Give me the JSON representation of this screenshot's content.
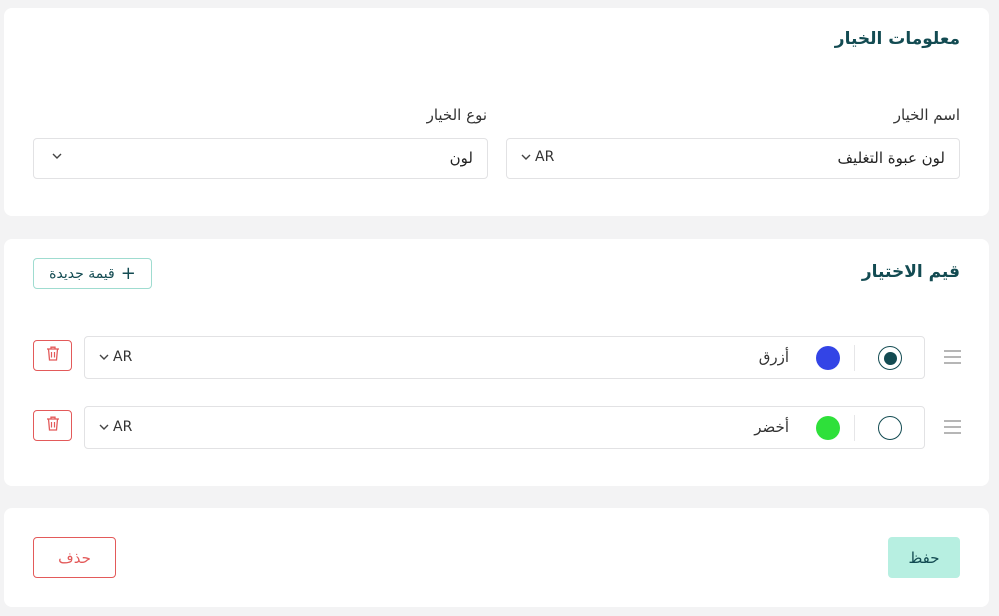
{
  "option_info": {
    "title": "معلومات الخيار",
    "name_label": "اسم الخيار",
    "name_value": "لون عبوة التغليف",
    "name_lang": "AR",
    "type_label": "نوع الخيار",
    "type_value": "لون"
  },
  "option_values": {
    "title": "قيم الاختيار",
    "new_value_label": "قيمة جديدة",
    "rows": [
      {
        "label": "أزرق",
        "color": "#3344e6",
        "lang": "AR",
        "selected": true
      },
      {
        "label": "أخضر",
        "color": "#2ee03a",
        "lang": "AR",
        "selected": false
      }
    ]
  },
  "actions": {
    "save_label": "حفظ",
    "delete_label": "حذف"
  },
  "colors": {
    "primary": "#134b52",
    "save_bg": "#b7efe1",
    "danger": "#e35a5a"
  }
}
